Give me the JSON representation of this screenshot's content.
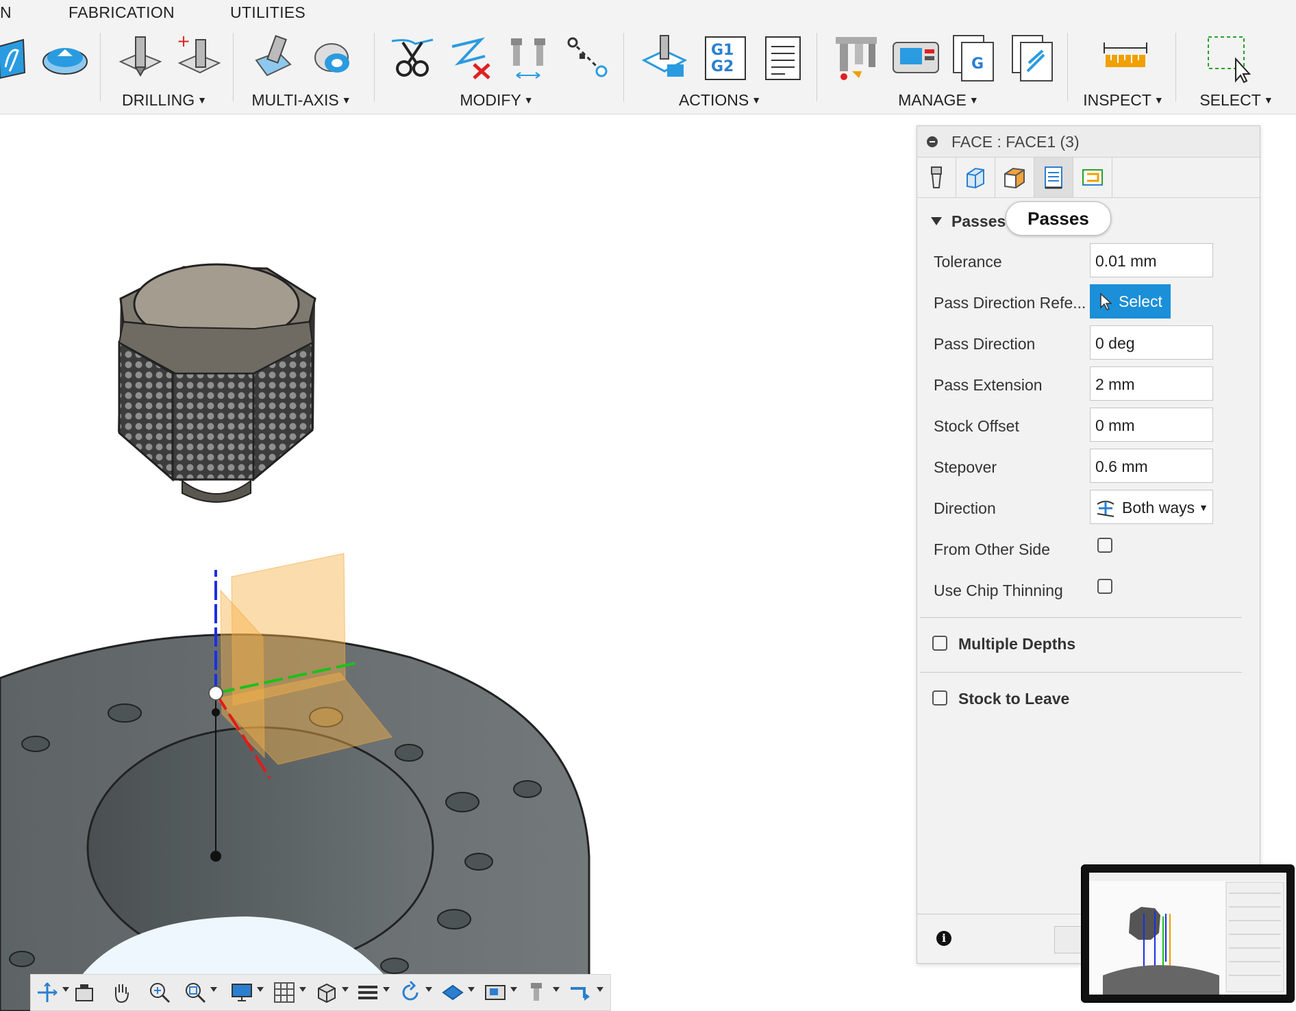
{
  "ribbon": {
    "tabs": [
      "N",
      "FABRICATION",
      "UTILITIES"
    ],
    "groups": {
      "drilling": "DRILLING",
      "multi_axis": "MULTI-AXIS",
      "modify": "MODIFY",
      "actions": "ACTIONS",
      "manage": "MANAGE",
      "inspect": "INSPECT",
      "select": "SELECT"
    },
    "actions_g_code_text": [
      "G1",
      "G2"
    ],
    "manage_g_text": "G"
  },
  "panel": {
    "title": "FACE : FACE1 (3)",
    "section": "Passes",
    "tooltip": "Passes",
    "rows": {
      "tolerance": {
        "label": "Tolerance",
        "value": "0.01 mm"
      },
      "pass_direction_ref": {
        "label": "Pass Direction Refe...",
        "button": "Select"
      },
      "pass_direction": {
        "label": "Pass Direction",
        "value": "0 deg"
      },
      "pass_extension": {
        "label": "Pass Extension",
        "value": "2 mm"
      },
      "stock_offset": {
        "label": "Stock Offset",
        "value": "0 mm"
      },
      "stepover": {
        "label": "Stepover",
        "value": "0.6 mm"
      },
      "direction": {
        "label": "Direction",
        "value": "Both ways"
      },
      "from_other_side": {
        "label": "From Other Side",
        "checked": false
      },
      "use_chip_thinning": {
        "label": "Use Chip Thinning",
        "checked": false
      }
    },
    "groups": {
      "multiple_depths": {
        "label": "Multiple Depths",
        "checked": false
      },
      "stock_to_leave": {
        "label": "Stock to Leave",
        "checked": false
      }
    }
  },
  "colors": {
    "accent": "#1b8fd8",
    "axis_x": "#e01b1b",
    "axis_y": "#19c219",
    "axis_z": "#1c2fe0",
    "plane": "#f7b24a"
  }
}
